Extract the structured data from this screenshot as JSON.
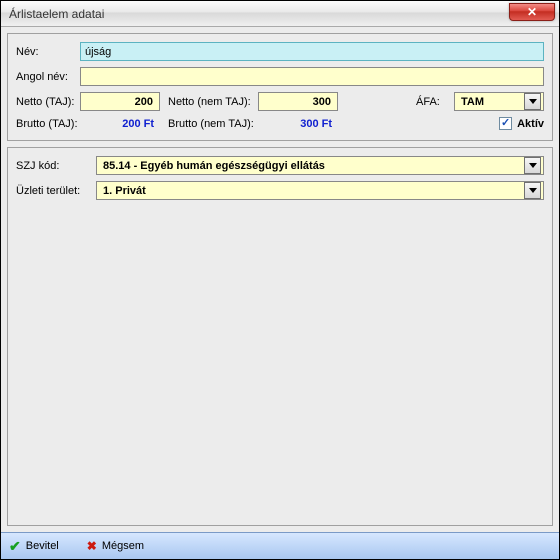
{
  "window": {
    "title": "Árlistaelem adatai"
  },
  "labels": {
    "nev": "Név:",
    "angol_nev": "Angol név:",
    "netto_taj": "Netto (TAJ):",
    "netto_nem_taj": "Netto (nem TAJ):",
    "afa": "ÁFA:",
    "brutto_taj": "Brutto (TAJ):",
    "brutto_nem_taj": "Brutto (nem TAJ):",
    "aktiv": "Aktív",
    "szj_kod": "SZJ kód:",
    "uzleti_terulet": "Üzleti terület:"
  },
  "values": {
    "nev": "újság",
    "angol_nev": "",
    "netto_taj": "200",
    "netto_nem_taj": "300",
    "brutto_taj": "200 Ft",
    "brutto_nem_taj": "300 Ft",
    "afa": "TAM",
    "aktiv_checked": "✓",
    "szj_kod": "85.14 - Egyéb humán egészségügyi ellátás",
    "uzleti_terulet": "1. Privát"
  },
  "footer": {
    "bevitel": "Bevitel",
    "megsem": "Mégsem"
  },
  "icons": {
    "close": "✕"
  }
}
